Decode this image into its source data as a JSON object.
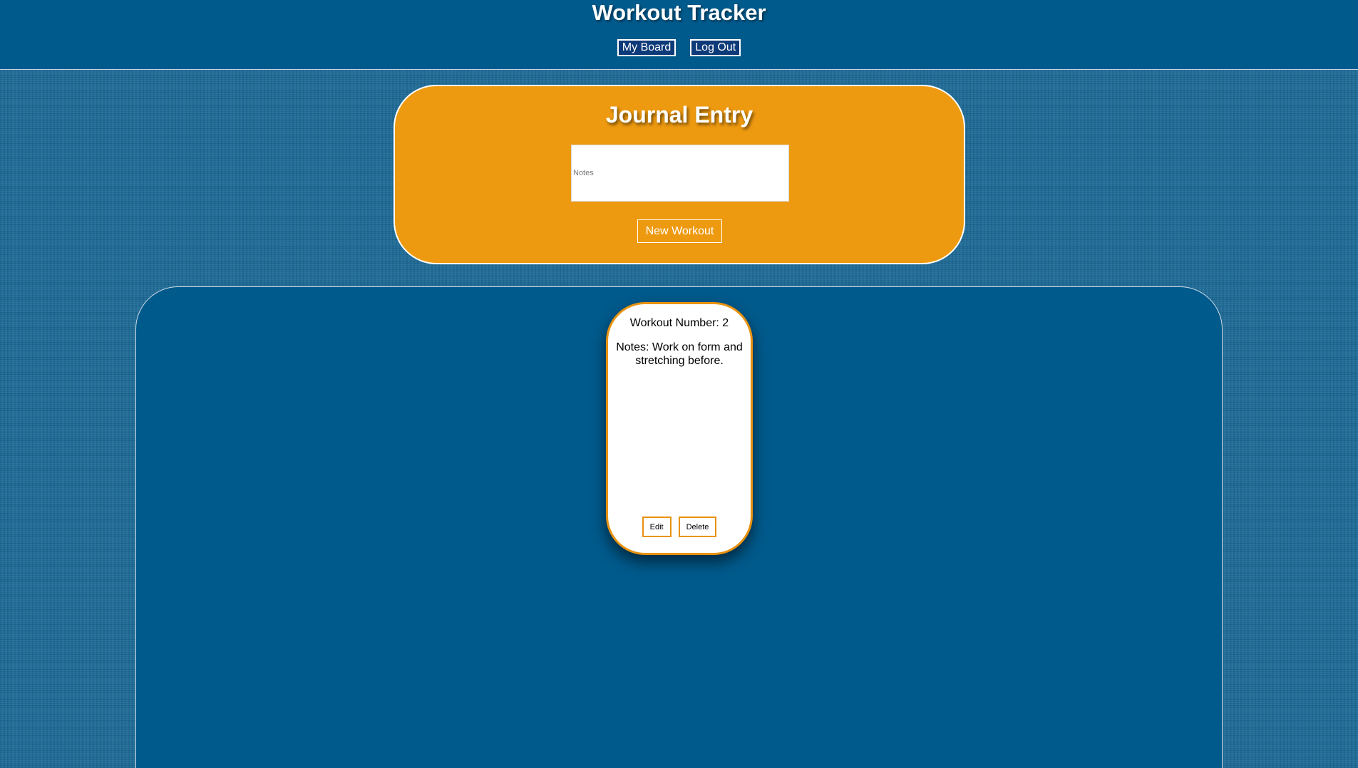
{
  "header": {
    "title": "Workout Tracker",
    "nav": [
      {
        "label": "My Board"
      },
      {
        "label": "Log Out"
      }
    ]
  },
  "journal": {
    "title": "Journal Entry",
    "notes_placeholder": "Notes",
    "notes_value": "",
    "submit_label": "New Workout"
  },
  "board": {
    "workouts": [
      {
        "number_text": "Workout Number: 2",
        "notes_text": "Notes: Work on form and stretching before.",
        "edit_label": "Edit",
        "delete_label": "Delete"
      }
    ]
  },
  "colors": {
    "header_bg": "#005a8c",
    "page_bg": "#1b6a98",
    "accent_orange": "#ee9a10",
    "nav_button_bg": "#0d3a78",
    "card_bg": "#ffffff"
  }
}
